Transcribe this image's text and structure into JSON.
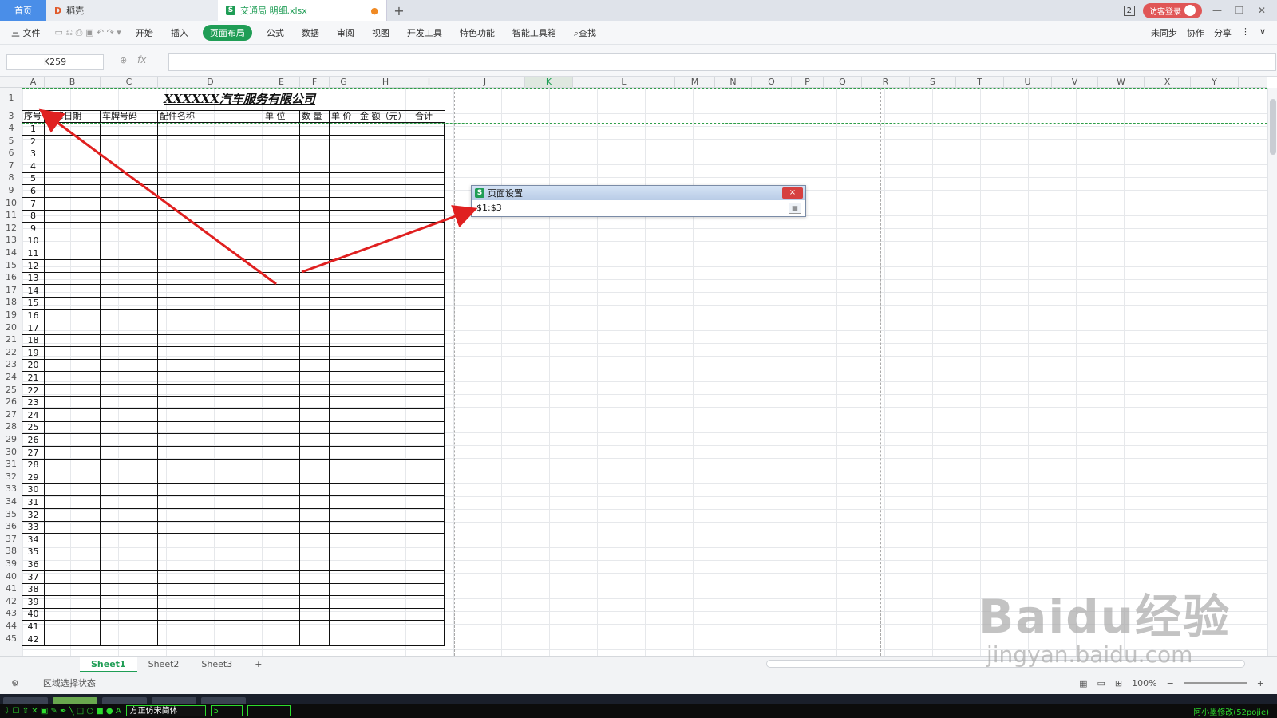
{
  "tabs": {
    "home": "首页",
    "daoke": "稻壳",
    "file": "交通局 明细.xlsx"
  },
  "titlebar": {
    "badge": "2",
    "login": "访客登录"
  },
  "toolbar": {
    "file_menu": "三 文件",
    "menus": [
      "开始",
      "插入",
      "页面布局",
      "公式",
      "数据",
      "审阅",
      "视图",
      "开发工具",
      "特色功能",
      "智能工具箱"
    ],
    "active_menu": "页面布局",
    "search": "查找",
    "right": [
      "未同步",
      "协作",
      "分享"
    ]
  },
  "formula_bar": {
    "cell_ref": "K259",
    "fx": "fx",
    "value": ""
  },
  "columns": [
    "A",
    "B",
    "C",
    "D",
    "E",
    "F",
    "G",
    "H",
    "I",
    "J",
    "K",
    "L",
    "M",
    "N",
    "O",
    "P",
    "Q",
    "R",
    "S",
    "T",
    "U",
    "V",
    "W",
    "X",
    "Y"
  ],
  "rows": [
    "1",
    "3",
    "4",
    "5",
    "6",
    "7",
    "8",
    "9",
    "10",
    "11",
    "12",
    "13",
    "14",
    "15",
    "16",
    "17",
    "18",
    "19",
    "20",
    "21",
    "22",
    "23",
    "24",
    "25",
    "26",
    "27",
    "28",
    "29",
    "30",
    "31",
    "32",
    "33",
    "34",
    "35",
    "36",
    "37",
    "38",
    "39",
    "40",
    "41",
    "42",
    "43",
    "44",
    "45"
  ],
  "sheet": {
    "title": "XXXXXX汽车服务有限公司",
    "headers": [
      "序号",
      "维修日期",
      "车牌号码",
      "配件名称",
      "单 位",
      "数 量",
      "单 价",
      "金 额（元）",
      "合计"
    ],
    "serials": [
      "1",
      "2",
      "3",
      "4",
      "5",
      "6",
      "7",
      "8",
      "9",
      "10",
      "11",
      "12",
      "13",
      "14",
      "15",
      "16",
      "17",
      "18",
      "19",
      "20",
      "21",
      "22",
      "23",
      "24",
      "25",
      "26",
      "27",
      "28",
      "29",
      "30",
      "31",
      "32",
      "33",
      "34",
      "35",
      "36",
      "37",
      "38",
      "39",
      "40",
      "41",
      "42"
    ]
  },
  "dialog": {
    "title": "页面设置",
    "range": "$1:$3",
    "close": "×"
  },
  "sheet_tabs": [
    "Sheet1",
    "Sheet2",
    "Sheet3"
  ],
  "add_sheet": "+",
  "status": {
    "mode": "区域选择状态",
    "zoom": "100%"
  },
  "drawtools": {
    "font": "方正仿宋简体",
    "size": "5",
    "note": "阿小墨修改(52pojie)"
  },
  "watermark": {
    "big": "Baidu经验",
    "small": "jingyan.baidu.com"
  },
  "colors": {
    "accent": "#1f9d55",
    "arrow": "#e02020",
    "dash": "#2e9d48"
  }
}
